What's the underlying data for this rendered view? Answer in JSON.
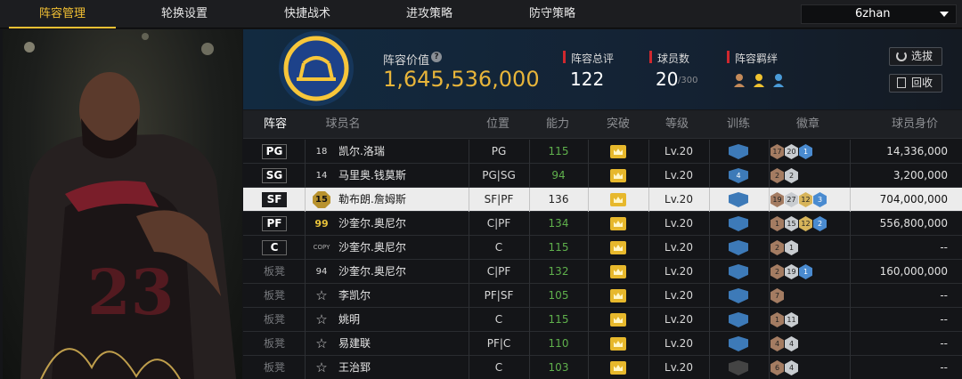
{
  "nav": {
    "tabs": [
      "阵容管理",
      "轮换设置",
      "快捷战术",
      "进攻策略",
      "防守策略"
    ],
    "server": "6zhan"
  },
  "summary": {
    "value_label": "阵容价值",
    "value": "1,645,536,000",
    "overall_label": "阵容总评",
    "overall": "122",
    "count_label": "球员数",
    "count": "20",
    "count_max": "/300",
    "bond_label": "阵容羁绊",
    "select_button": "选拔",
    "recycle_button": "回收"
  },
  "table": {
    "headers": [
      "阵容",
      "球员名",
      "位置",
      "能力",
      "突破",
      "等级",
      "训练",
      "徽章",
      "球员身价"
    ],
    "rows": [
      {
        "slot": "PG",
        "starter": true,
        "jersey": "18",
        "jersey_style": "plain",
        "name": "凯尔.洛瑞",
        "position": "PG",
        "ability": "115",
        "ability_green": true,
        "level": "Lv.20",
        "training": "",
        "badges": [
          {
            "v": "17",
            "c": "br"
          },
          {
            "v": "20",
            "c": "si"
          },
          {
            "v": "1",
            "c": "bl"
          }
        ],
        "value": "14,336,000"
      },
      {
        "slot": "SG",
        "starter": true,
        "jersey": "14",
        "jersey_style": "plain",
        "name": "马里奥.钱莫斯",
        "position": "PG|SG",
        "ability": "94",
        "ability_green": true,
        "level": "Lv.20",
        "training": "4",
        "badges": [
          {
            "v": "2",
            "c": "br"
          },
          {
            "v": "2",
            "c": "si"
          }
        ],
        "value": "3,200,000"
      },
      {
        "slot": "SF",
        "starter": true,
        "selected": true,
        "jersey": "15",
        "jersey_style": "octo",
        "name": "勒布朗.詹姆斯",
        "position": "SF|PF",
        "ability": "136",
        "ability_green": false,
        "level": "Lv.20",
        "training": "",
        "badges": [
          {
            "v": "19",
            "c": "br"
          },
          {
            "v": "27",
            "c": "si"
          },
          {
            "v": "12",
            "c": "go"
          },
          {
            "v": "3",
            "c": "bl"
          }
        ],
        "value": "704,000,000"
      },
      {
        "slot": "PF",
        "starter": true,
        "jersey": "99",
        "jersey_style": "gold",
        "name": "沙奎尔.奥尼尔",
        "position": "C|PF",
        "ability": "134",
        "ability_green": true,
        "level": "Lv.20",
        "training": "",
        "badges": [
          {
            "v": "1",
            "c": "br"
          },
          {
            "v": "15",
            "c": "si"
          },
          {
            "v": "12",
            "c": "go"
          },
          {
            "v": "2",
            "c": "bl"
          }
        ],
        "value": "556,800,000"
      },
      {
        "slot": "C",
        "starter": true,
        "jersey": "COPY",
        "jersey_style": "copy",
        "name": "沙奎尔.奥尼尔",
        "position": "C",
        "ability": "115",
        "ability_green": true,
        "level": "Lv.20",
        "training": "",
        "badges": [
          {
            "v": "2",
            "c": "br"
          },
          {
            "v": "1",
            "c": "si"
          }
        ],
        "value": "--"
      },
      {
        "slot": "板凳",
        "starter": false,
        "jersey": "94",
        "jersey_style": "plain",
        "name": "沙奎尔.奥尼尔",
        "position": "C|PF",
        "ability": "132",
        "ability_green": true,
        "level": "Lv.20",
        "training": "",
        "badges": [
          {
            "v": "2",
            "c": "br"
          },
          {
            "v": "19",
            "c": "si"
          },
          {
            "v": "1",
            "c": "bl"
          }
        ],
        "value": "160,000,000"
      },
      {
        "slot": "板凳",
        "starter": false,
        "jersey": "☆",
        "jersey_style": "star",
        "name": "李凯尔",
        "position": "PF|SF",
        "ability": "105",
        "ability_green": true,
        "level": "Lv.20",
        "training": "",
        "badges": [
          {
            "v": "7",
            "c": "br"
          }
        ],
        "value": "--"
      },
      {
        "slot": "板凳",
        "starter": false,
        "jersey": "☆",
        "jersey_style": "star",
        "name": "姚明",
        "position": "C",
        "ability": "115",
        "ability_green": true,
        "level": "Lv.20",
        "training": "",
        "badges": [
          {
            "v": "1",
            "c": "br"
          },
          {
            "v": "11",
            "c": "si"
          }
        ],
        "value": "--"
      },
      {
        "slot": "板凳",
        "starter": false,
        "jersey": "☆",
        "jersey_style": "star",
        "name": "易建联",
        "position": "PF|C",
        "ability": "110",
        "ability_green": true,
        "level": "Lv.20",
        "training": "",
        "badges": [
          {
            "v": "4",
            "c": "br"
          },
          {
            "v": "4",
            "c": "si"
          }
        ],
        "value": "--"
      },
      {
        "slot": "板凳",
        "starter": false,
        "jersey": "☆",
        "jersey_style": "star",
        "name": "王治郅",
        "position": "C",
        "ability": "103",
        "ability_green": true,
        "level": "Lv.20",
        "training": "",
        "training_grey": true,
        "badges": [
          {
            "v": "6",
            "c": "br"
          },
          {
            "v": "4",
            "c": "si"
          }
        ],
        "value": "--"
      }
    ]
  },
  "colors": {
    "accent": "#f2c033",
    "brand_red": "#d0282e",
    "green": "#5fb04c",
    "blue": "#3d7ab8"
  }
}
